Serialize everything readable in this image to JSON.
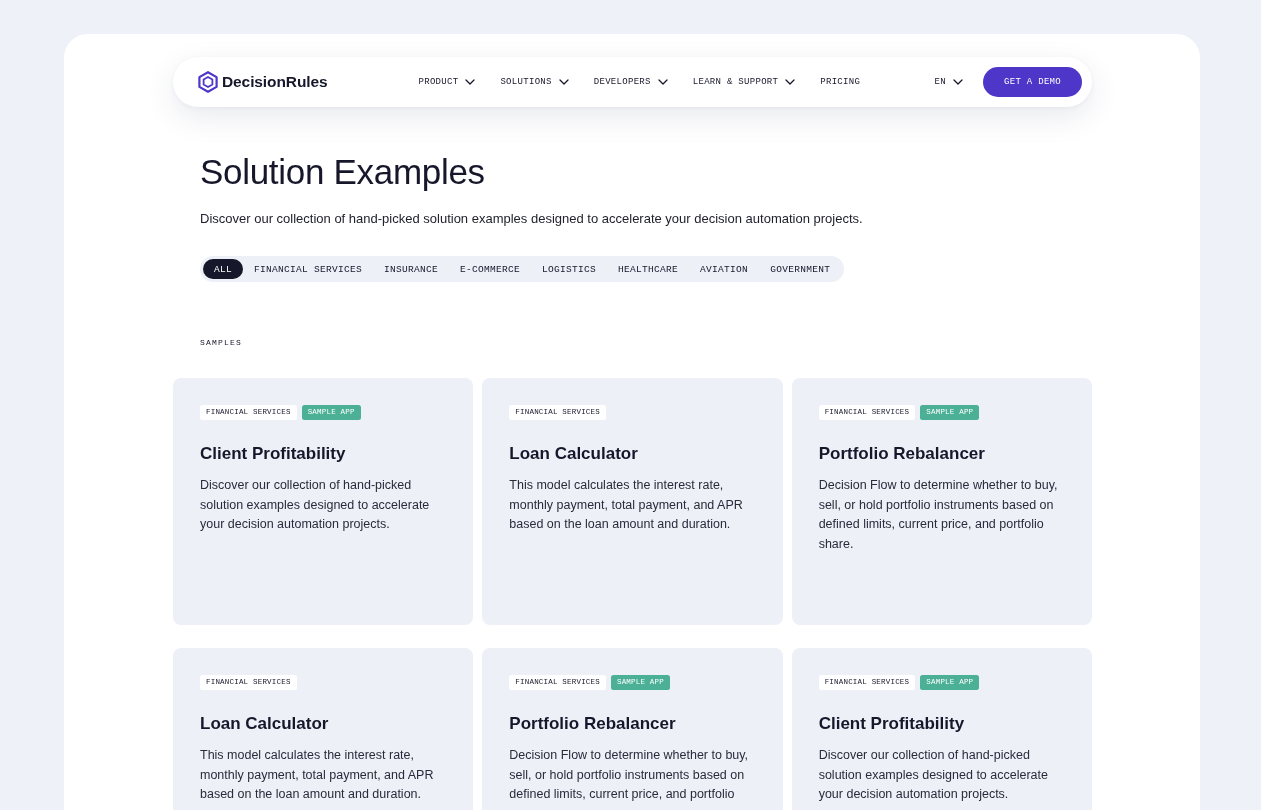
{
  "brand": {
    "name": "DecisionRules"
  },
  "nav": {
    "items": [
      {
        "label": "PRODUCT",
        "dropdown": true
      },
      {
        "label": "SOLUTIONS",
        "dropdown": true
      },
      {
        "label": "DEVELOPERS",
        "dropdown": true
      },
      {
        "label": "LEARN & SUPPORT",
        "dropdown": true
      },
      {
        "label": "PRICING",
        "dropdown": false
      }
    ],
    "language": "EN",
    "cta": "GET A DEMO"
  },
  "hero": {
    "title": "Solution Examples",
    "subtitle": "Discover our collection of hand-picked solution examples designed to accelerate your decision automation projects."
  },
  "filters": [
    {
      "label": "ALL",
      "selected": true
    },
    {
      "label": "FINANCIAL SERVICES",
      "selected": false
    },
    {
      "label": "INSURANCE",
      "selected": false
    },
    {
      "label": "E-COMMERCE",
      "selected": false
    },
    {
      "label": "LOGISTICS",
      "selected": false
    },
    {
      "label": "HEALTHCARE",
      "selected": false
    },
    {
      "label": "AVIATION",
      "selected": false
    },
    {
      "label": "GOVERNMENT",
      "selected": false
    }
  ],
  "section_label": "SAMPLES",
  "cards": [
    {
      "tags": [
        {
          "label": "FINANCIAL SERVICES",
          "kind": "category"
        },
        {
          "label": "SAMPLE APP",
          "kind": "sample"
        }
      ],
      "title": "Client Profitability",
      "description": "Discover our collection of hand-picked solution examples designed to accelerate your decision automation projects."
    },
    {
      "tags": [
        {
          "label": "FINANCIAL SERVICES",
          "kind": "category"
        }
      ],
      "title": "Loan Calculator",
      "description": "This model calculates the interest rate, monthly payment, total payment, and APR based on the loan amount and duration."
    },
    {
      "tags": [
        {
          "label": "FINANCIAL SERVICES",
          "kind": "category"
        },
        {
          "label": "SAMPLE APP",
          "kind": "sample"
        }
      ],
      "title": "Portfolio Rebalancer",
      "description": "Decision Flow to determine whether to buy, sell, or hold portfolio instruments based on defined limits, current price, and portfolio share."
    },
    {
      "tags": [
        {
          "label": "FINANCIAL SERVICES",
          "kind": "category"
        }
      ],
      "title": "Loan Calculator",
      "description": "This model calculates the interest rate, monthly payment, total payment, and APR based on the loan amount and duration."
    },
    {
      "tags": [
        {
          "label": "FINANCIAL SERVICES",
          "kind": "category"
        },
        {
          "label": "SAMPLE APP",
          "kind": "sample"
        }
      ],
      "title": "Portfolio Rebalancer",
      "description": "Decision Flow to determine whether to buy, sell, or hold portfolio instruments based on defined limits, current price, and portfolio"
    },
    {
      "tags": [
        {
          "label": "FINANCIAL SERVICES",
          "kind": "category"
        },
        {
          "label": "SAMPLE APP",
          "kind": "sample"
        }
      ],
      "title": "Client Profitability",
      "description": "Discover our collection of hand-picked solution examples designed to accelerate your decision automation projects."
    }
  ]
}
